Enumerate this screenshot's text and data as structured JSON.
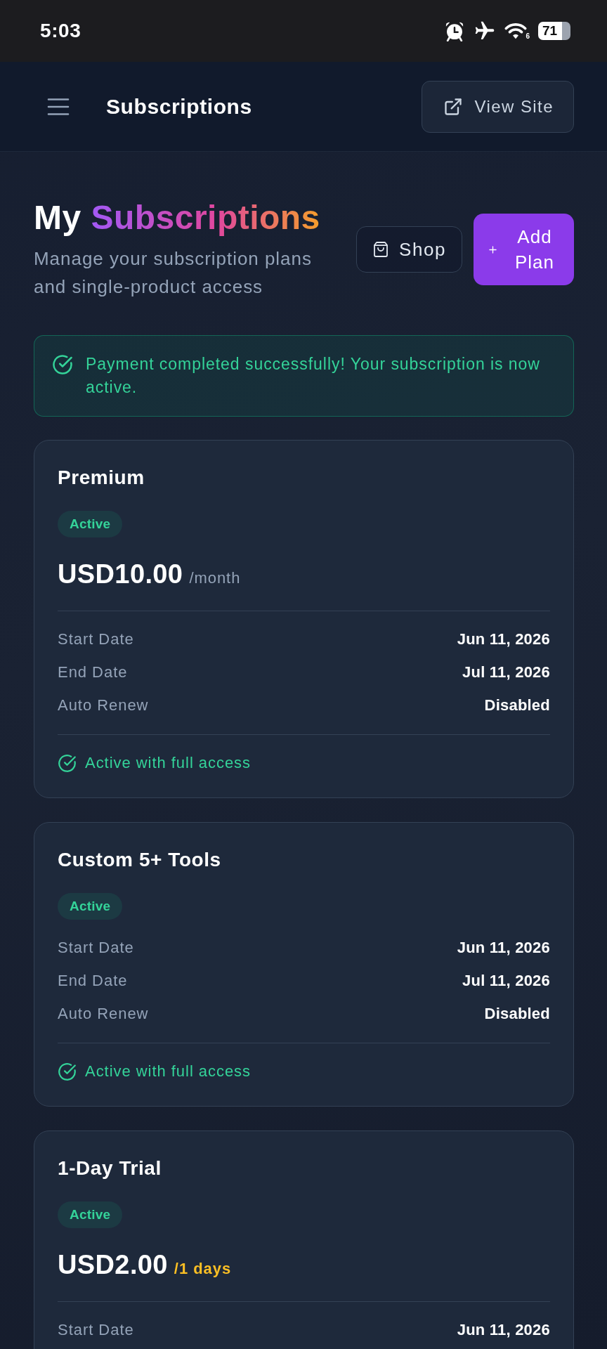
{
  "status_bar": {
    "time": "5:03",
    "wifi_standard": "6",
    "battery": "71"
  },
  "header": {
    "title": "Subscriptions",
    "view_site_button": "View Site"
  },
  "intro": {
    "title_lead": "My",
    "title_highlight": "Subscriptions",
    "subtitle": "Manage your subscription plans and single-product access",
    "shop_button": "Shop",
    "add_plan_button": "Add Plan"
  },
  "alert": {
    "kind": "success",
    "message": "Payment completed successfully! Your subscription is now active."
  },
  "subscriptions": [
    {
      "name": "Premium",
      "status": {
        "label": "Active",
        "kind": "active"
      },
      "price": "USD10.00",
      "period": "/month",
      "period_highlighted": false,
      "details": [
        {
          "label": "Start Date",
          "value": "Jun 11, 2026"
        },
        {
          "label": "End Date",
          "value": "Jul 11, 2026"
        },
        {
          "label": "Auto Renew",
          "value": "Disabled"
        }
      ],
      "access_note": "Active with full access"
    },
    {
      "name": "Custom 5+ Tools",
      "status": {
        "label": "Active",
        "kind": "active"
      },
      "details": [
        {
          "label": "Start Date",
          "value": "Jun 11, 2026"
        },
        {
          "label": "End Date",
          "value": "Jul 11, 2026"
        },
        {
          "label": "Auto Renew",
          "value": "Disabled"
        }
      ],
      "access_note": "Active with full access"
    },
    {
      "name": "1-Day Trial",
      "status": {
        "label": "Active",
        "kind": "active"
      },
      "price": "USD2.00",
      "period": "/1 days",
      "period_highlighted": true,
      "details": [
        {
          "label": "Start Date",
          "value": "Jun 11, 2026"
        }
      ]
    }
  ]
}
